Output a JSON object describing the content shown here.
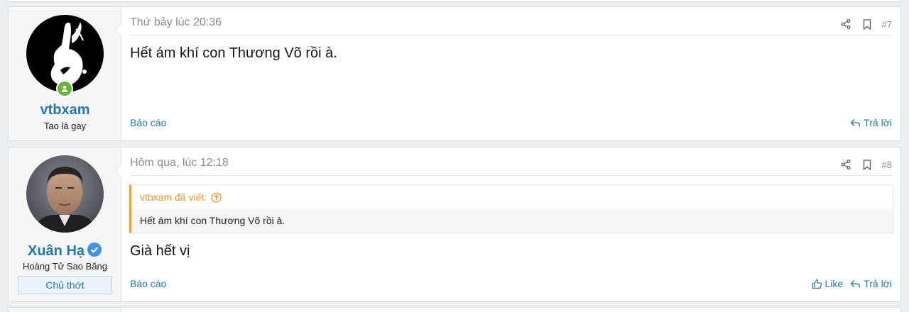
{
  "posts": [
    {
      "username": "vtbxam",
      "user_title": "Tao là gay",
      "online": true,
      "time": "Thứ bảy lúc 20:36",
      "number": "#7",
      "message": "Hết ám khí con Thương Võ rồi à.",
      "report_label": "Báo cáo",
      "reply_label": "Trả lời"
    },
    {
      "username": "Xuân Hạ",
      "verified": true,
      "user_title": "Hoàng Tử Sao Băng",
      "role_banner": "Chủ thớt",
      "time": "Hôm qua, lúc 12:18",
      "number": "#8",
      "quote": {
        "author": "vtbxam đã viết:",
        "text": "Hết ám khí con Thương Võ rồi à."
      },
      "message": "Già hết vị",
      "report_label": "Báo cáo",
      "like_label": "Like",
      "reply_label": "Trả lời"
    }
  ],
  "icons": {
    "share": "share-icon",
    "bookmark": "bookmark-icon",
    "like": "thumbs-up-icon",
    "reply": "reply-icon",
    "online": "user-online-icon",
    "verified": "verified-check-icon",
    "quote_jump": "arrow-up-circle-icon"
  },
  "colors": {
    "link": "#2577b1",
    "quote_accent": "#f0a030",
    "online": "#63b335",
    "verified": "#3b95e6"
  }
}
